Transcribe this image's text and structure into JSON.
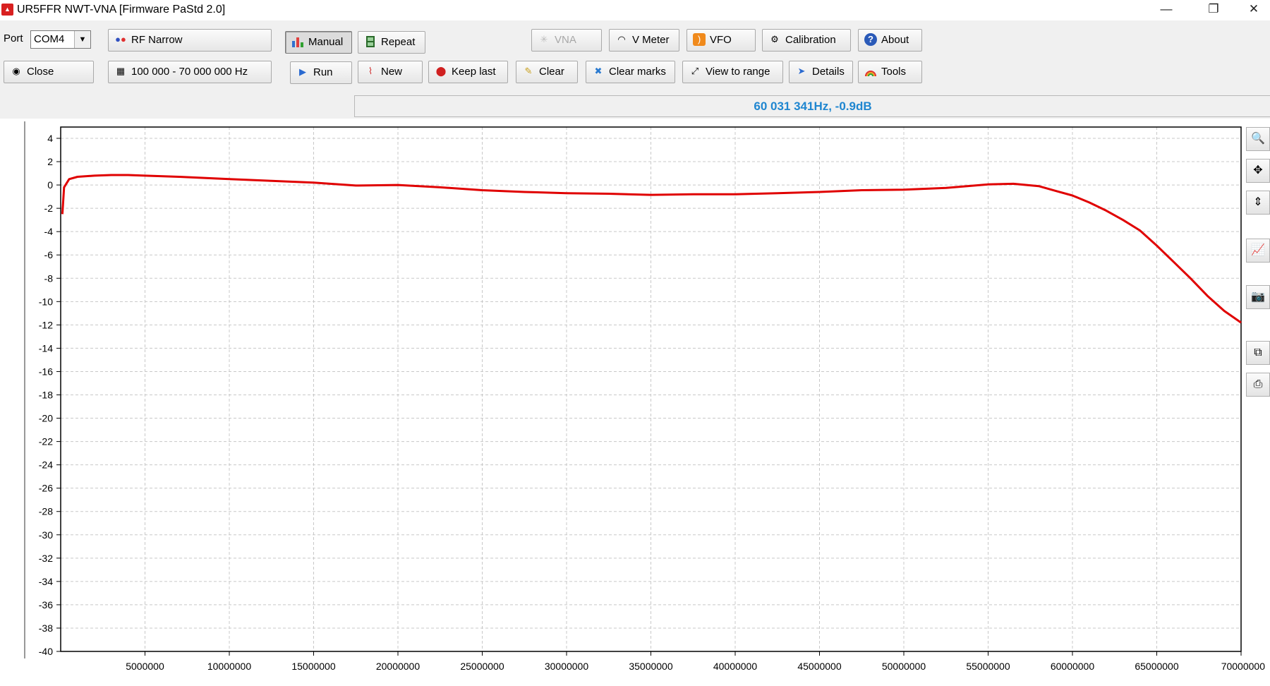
{
  "window": {
    "title": "UR5FFR NWT-VNA [Firmware PaStd 2.0]",
    "minimize_glyph": "—",
    "restore_glyph": "❐",
    "close_glyph": "✕"
  },
  "port": {
    "label": "Port",
    "value": "COM4"
  },
  "buttons": {
    "rf_narrow": "RF Narrow",
    "manual": "Manual",
    "repeat": "Repeat",
    "vna": "VNA",
    "vmeter": "V Meter",
    "vfo": "VFO",
    "calibration": "Calibration",
    "about": "About",
    "close": "Close",
    "range": "100 000 - 70 000 000 Hz",
    "run": "Run",
    "new": "New",
    "keep_last": "Keep last",
    "clear": "Clear",
    "clear_marks": "Clear marks",
    "view_to_range": "View to range",
    "details": "Details",
    "tools": "Tools"
  },
  "status_text": "60 031 341Hz, -0.9dB",
  "icons": {
    "rf_narrow": "dots-icon",
    "manual": "bar-chart-icon",
    "repeat": "film-icon",
    "vna": "spinner-icon",
    "vmeter": "gauge-icon",
    "vfo": "rss-icon",
    "calibration": "gear-icon",
    "about": "help-icon",
    "close": "eye-icon",
    "range": "calendar-icon",
    "run": "play-icon",
    "new": "chart-new-icon",
    "keep_last": "pin-icon",
    "clear": "broom-icon",
    "clear_marks": "marker-remove-icon",
    "view_to_range": "expand-icon",
    "details": "cursor-details-icon",
    "tools": "rainbow-icon"
  },
  "side_tools": [
    "zoom-icon",
    "fit-icon",
    "vertical-fit-icon",
    "chart-icon",
    "camera-icon",
    "copy-icon",
    "print-icon"
  ],
  "colors": {
    "trace": "#e00000",
    "status": "#1f86d0",
    "grid": "#c8c8c8"
  },
  "chart_data": {
    "type": "line",
    "title": "",
    "xlabel": "",
    "ylabel": "",
    "xlim": [
      100000,
      70000000
    ],
    "ylim": [
      -40,
      5
    ],
    "grid": true,
    "x_ticks": [
      5000000,
      10000000,
      15000000,
      20000000,
      25000000,
      30000000,
      35000000,
      40000000,
      45000000,
      50000000,
      55000000,
      60000000,
      65000000,
      70000000
    ],
    "x_tick_labels": [
      "5000000",
      "10000000",
      "15000000",
      "20000000",
      "25000000",
      "30000000",
      "35000000",
      "40000000",
      "45000000",
      "50000000",
      "55000000",
      "60000000",
      "65000000",
      "70000000"
    ],
    "y_ticks": [
      4,
      2,
      0,
      -2,
      -4,
      -6,
      -8,
      -10,
      -12,
      -14,
      -16,
      -18,
      -20,
      -22,
      -24,
      -26,
      -28,
      -30,
      -32,
      -34,
      -36,
      -38,
      -40
    ],
    "y_tick_labels": [
      "4",
      "2",
      "0",
      "-2",
      "-4",
      "-6",
      "-8",
      "-10",
      "-12",
      "-14",
      "-16",
      "-18",
      "-20",
      "-22",
      "-24",
      "-26",
      "-28",
      "-30",
      "-32",
      "-34",
      "-36",
      "-38",
      "-40"
    ],
    "series": [
      {
        "x": [
          100000,
          200000,
          500000,
          1000000,
          2000000,
          3000000,
          4000000,
          5000000,
          7000000,
          10000000,
          12500000,
          15000000,
          17500000,
          20000000,
          22500000,
          25000000,
          27500000,
          30000000,
          32500000,
          35000000,
          37500000,
          40000000,
          42500000,
          45000000,
          47500000,
          50000000,
          52500000,
          55000000,
          56500000,
          58000000,
          59000000,
          60000000,
          61000000,
          62000000,
          63000000,
          64000000,
          65000000,
          66000000,
          67000000,
          68000000,
          69000000,
          70000000
        ],
        "y": [
          -2.5,
          -0.2,
          0.5,
          0.7,
          0.8,
          0.85,
          0.85,
          0.8,
          0.7,
          0.5,
          0.35,
          0.2,
          -0.05,
          0.0,
          -0.2,
          -0.45,
          -0.6,
          -0.7,
          -0.75,
          -0.85,
          -0.8,
          -0.8,
          -0.7,
          -0.6,
          -0.45,
          -0.4,
          -0.25,
          0.05,
          0.1,
          -0.1,
          -0.5,
          -0.9,
          -1.5,
          -2.2,
          -3.0,
          -3.9,
          -5.2,
          -6.6,
          -8.0,
          -9.5,
          -10.8,
          -11.8
        ]
      }
    ]
  }
}
